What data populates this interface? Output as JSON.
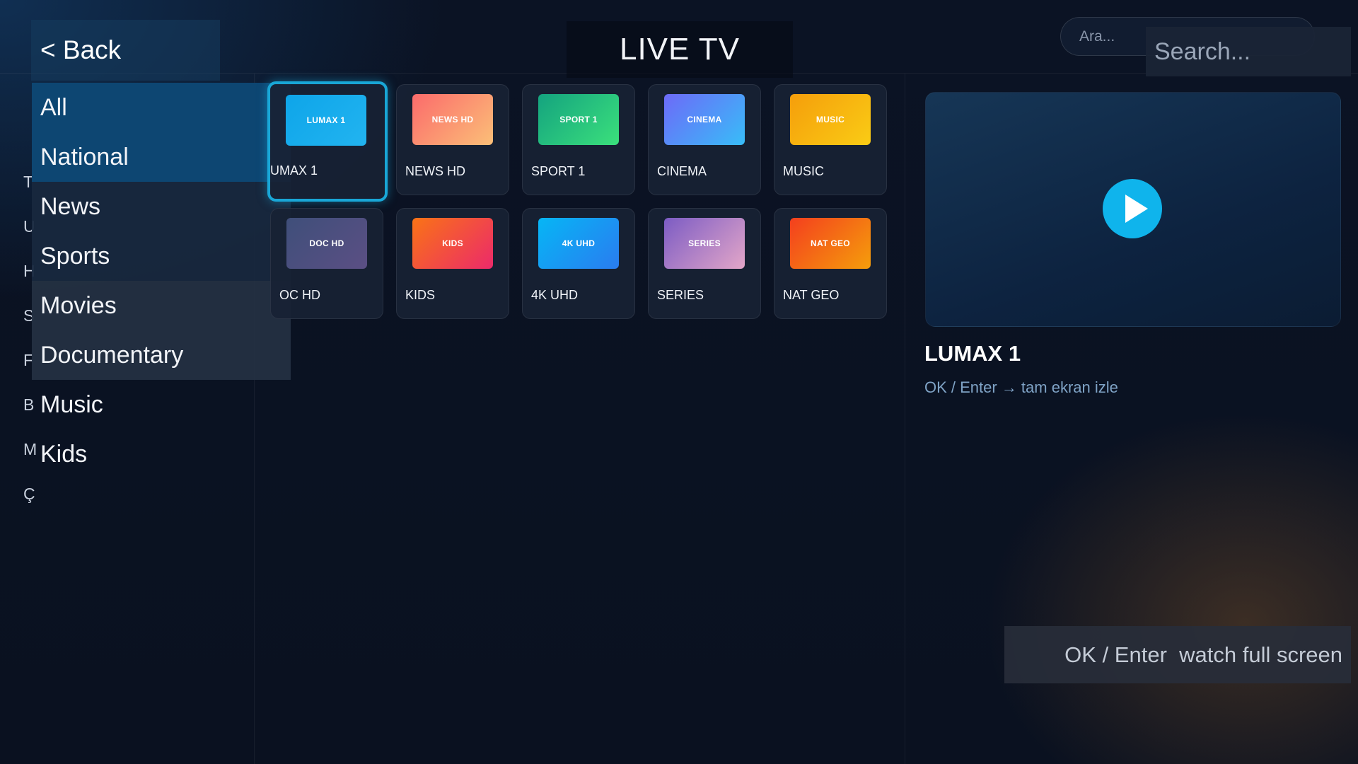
{
  "header": {
    "back_label": "< Back",
    "title": "LIVE TV",
    "search_small_placeholder": "Ara...",
    "search_big_placeholder": "Search..."
  },
  "sidebar": {
    "hidden_letters": [
      "T",
      "U",
      "H",
      "S",
      "F",
      "B",
      "M",
      "Ç"
    ],
    "categories": [
      {
        "label": "All",
        "state": "selected"
      },
      {
        "label": "National",
        "state": "selected"
      },
      {
        "label": "News",
        "state": "highlight"
      },
      {
        "label": "Sports",
        "state": "highlight"
      },
      {
        "label": "Movies",
        "state": "hover"
      },
      {
        "label": "Documentary",
        "state": "hover"
      },
      {
        "label": "Music",
        "state": "plain"
      },
      {
        "label": "Kids",
        "state": "plain"
      }
    ]
  },
  "channels": [
    {
      "logo": "LUMAX 1",
      "name": "UMAX 1",
      "colors": [
        "#0ea5e9",
        "#22b4f0"
      ],
      "focused": true
    },
    {
      "logo": "NEWS HD",
      "name": "NEWS HD",
      "colors": [
        "#fb6b6b",
        "#fbbf78"
      ],
      "focused": false
    },
    {
      "logo": "SPORT 1",
      "name": "SPORT 1",
      "colors": [
        "#14a37f",
        "#3be07c"
      ],
      "focused": false
    },
    {
      "logo": "CINEMA",
      "name": "CINEMA",
      "colors": [
        "#6d6af8",
        "#38bdf8"
      ],
      "focused": false
    },
    {
      "logo": "MUSIC",
      "name": "MUSIC",
      "colors": [
        "#f59e0b",
        "#facc15"
      ],
      "focused": false
    },
    {
      "logo": "DOC HD",
      "name": "OC HD",
      "colors": [
        "#3f4f7a",
        "#5b4f84"
      ],
      "focused": false
    },
    {
      "logo": "KIDS",
      "name": "KIDS",
      "colors": [
        "#f97316",
        "#ec2a6a"
      ],
      "focused": false
    },
    {
      "logo": "4K UHD",
      "name": "4K UHD",
      "colors": [
        "#06b6f5",
        "#2a7cf0"
      ],
      "focused": false
    },
    {
      "logo": "SERIES",
      "name": "SERIES",
      "colors": [
        "#7c5cc4",
        "#e3a6c8"
      ],
      "focused": false
    },
    {
      "logo": "NAT GEO",
      "name": "NAT GEO",
      "colors": [
        "#f43f1e",
        "#f59e0b"
      ],
      "focused": false
    }
  ],
  "preview": {
    "title": "LUMAX 1",
    "hint": "OK / Enter → tam ekran izle",
    "fullscreen_label": "OK / Enter  watch full screen",
    "play_icon": "play-icon"
  }
}
